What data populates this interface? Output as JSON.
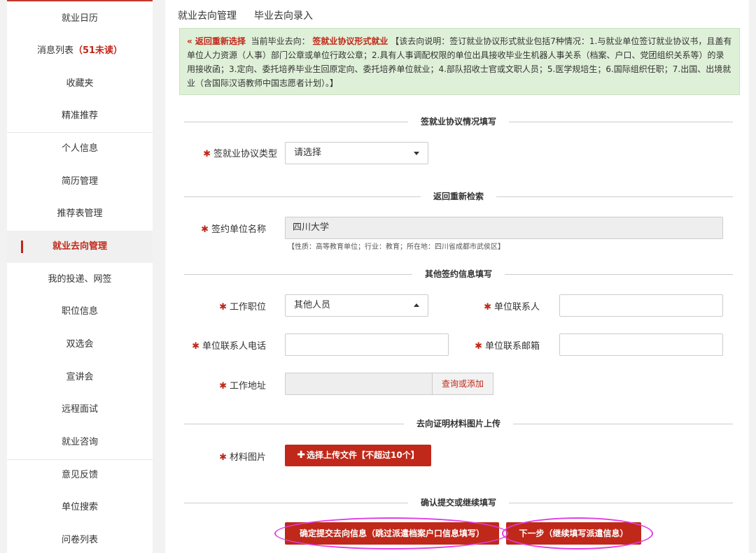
{
  "sidebar": {
    "items": [
      {
        "label": "就业日历"
      },
      {
        "label": "消息列表",
        "unread": "（51未读）"
      },
      {
        "label": "收藏夹"
      },
      {
        "label": "精准推荐"
      },
      {
        "label": "个人信息"
      },
      {
        "label": "简历管理"
      },
      {
        "label": "推荐表管理"
      },
      {
        "label": "就业去向管理",
        "active": true
      },
      {
        "label": "我的投递、网签"
      },
      {
        "label": "职位信息"
      },
      {
        "label": "双选会"
      },
      {
        "label": "宣讲会"
      },
      {
        "label": "远程面试"
      },
      {
        "label": "就业咨询"
      },
      {
        "label": "意见反馈"
      },
      {
        "label": "单位搜索"
      },
      {
        "label": "问卷列表"
      }
    ]
  },
  "tabs": [
    {
      "label": "就业去向管理",
      "active": false
    },
    {
      "label": "毕业去向录入",
      "active": true
    }
  ],
  "notice": {
    "back_link": "« 返回重新选择",
    "current_label": "当前毕业去向：",
    "current_value": "签就业协议形式就业",
    "description": "【该去向说明：签订就业协议形式就业包括7种情况：1.与就业单位签订就业协议书，且盖有单位人力资源（人事）部门公章或单位行政公章；2.具有人事调配权限的单位出具接收毕业生机器人事关系（档案、户口、党团组织关系等）的录用接收函；3.定向、委托培养毕业生回原定向、委托培养单位就业；4.部队招收士官或文职人员；5.医学规培生；6.国际组织任职；7.出国、出境就业（含国际汉语教师中国志愿者计划）。】"
  },
  "sections": {
    "agreement": "签就业协议情况填写",
    "research": "返回重新检索",
    "other": "其他签约信息填写",
    "upload": "去向证明材料图片上传",
    "confirm": "确认提交或继续填写"
  },
  "form": {
    "required_mark": "✱",
    "agreement_type": {
      "label": "签就业协议类型",
      "value": "请选择"
    },
    "unit_name": {
      "label": "签约单位名称",
      "value": "四川大学",
      "hint": "【性质：高等教育单位；行业：教育；所在地：四川省成都市武侯区】"
    },
    "job_position": {
      "label": "工作职位",
      "value": "其他人员"
    },
    "contact_person": {
      "label": "单位联系人",
      "value": ""
    },
    "contact_phone": {
      "label": "单位联系人电话",
      "value": ""
    },
    "contact_email": {
      "label": "单位联系邮箱",
      "value": ""
    },
    "work_address": {
      "label": "工作地址",
      "value": "",
      "button": "查询或添加"
    },
    "material_images": {
      "label": "材料图片",
      "button": "选择上传文件【不超过10个】"
    }
  },
  "actions": {
    "submit": "确定提交去向信息（跳过派遣档案户口信息填写）",
    "next": "下一步（继续填写派遣信息）"
  },
  "colors": {
    "accent": "#c0281a",
    "notice_bg": "#dff0d8",
    "highlight_ring": "#e23ce6"
  }
}
